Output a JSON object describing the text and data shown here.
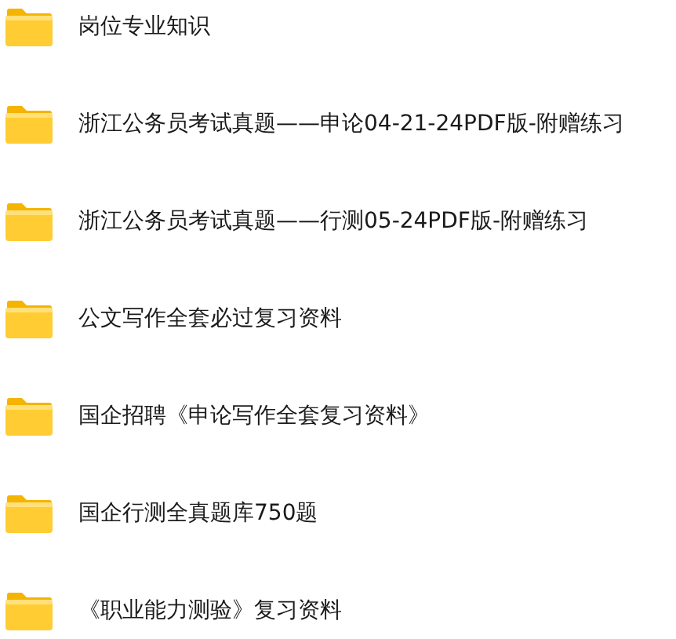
{
  "folders": [
    {
      "name": "岗位专业知识"
    },
    {
      "name": "浙江公务员考试真题——申论04-21-24PDF版-附赠练习"
    },
    {
      "name": "浙江公务员考试真题——行测05-24PDF版-附赠练习"
    },
    {
      "name": "公文写作全套必过复习资料"
    },
    {
      "name": "国企招聘《申论写作全套复习资料》"
    },
    {
      "name": "国企行测全真题库750题"
    },
    {
      "name": "《职业能力测验》复习资料"
    }
  ]
}
